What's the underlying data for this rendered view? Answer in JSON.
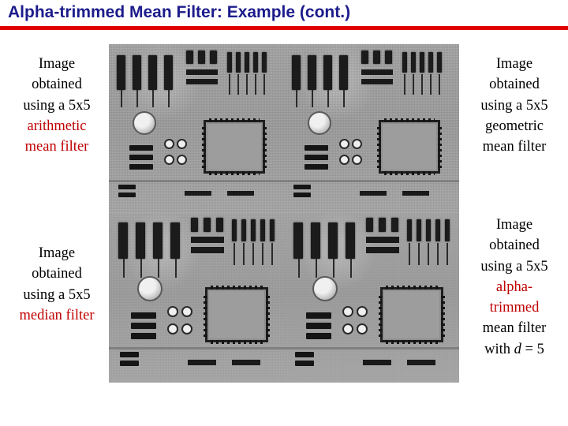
{
  "slide": {
    "title": "Alpha-trimmed Mean Filter: Example (cont.)",
    "accent_color": "#1c1c8c",
    "rule_color": "#e00000"
  },
  "captions": {
    "top_left": {
      "line1": "Image",
      "line2": "obtained",
      "line3": "using a 5x5",
      "line4": "arithmetic",
      "line5": "mean filter",
      "highlight_color": "#c00000"
    },
    "top_right": {
      "line1": "Image",
      "line2": "obtained",
      "line3": "using a 5x5",
      "line4": "geometric",
      "line5": "mean filter"
    },
    "bottom_left": {
      "line1": "Image",
      "line2": "obtained",
      "line3": "using a 5x5",
      "line4": "median filter",
      "highlight_color": "#c00000"
    },
    "bottom_right": {
      "line1": "Image",
      "line2": "obtained",
      "line3": "using a 5x5",
      "line4": "alpha-",
      "line5": "trimmed",
      "line6": "mean filter",
      "line7_prefix": "with ",
      "line7_var": "d",
      "line7_suffix": " = 5"
    }
  },
  "images": {
    "top_left": "circuit-board-arithmetic-mean-5x5",
    "top_right": "circuit-board-geometric-mean-5x5",
    "bottom_left": "circuit-board-median-5x5",
    "bottom_right": "circuit-board-alpha-trimmed-mean-5x5-d5"
  }
}
